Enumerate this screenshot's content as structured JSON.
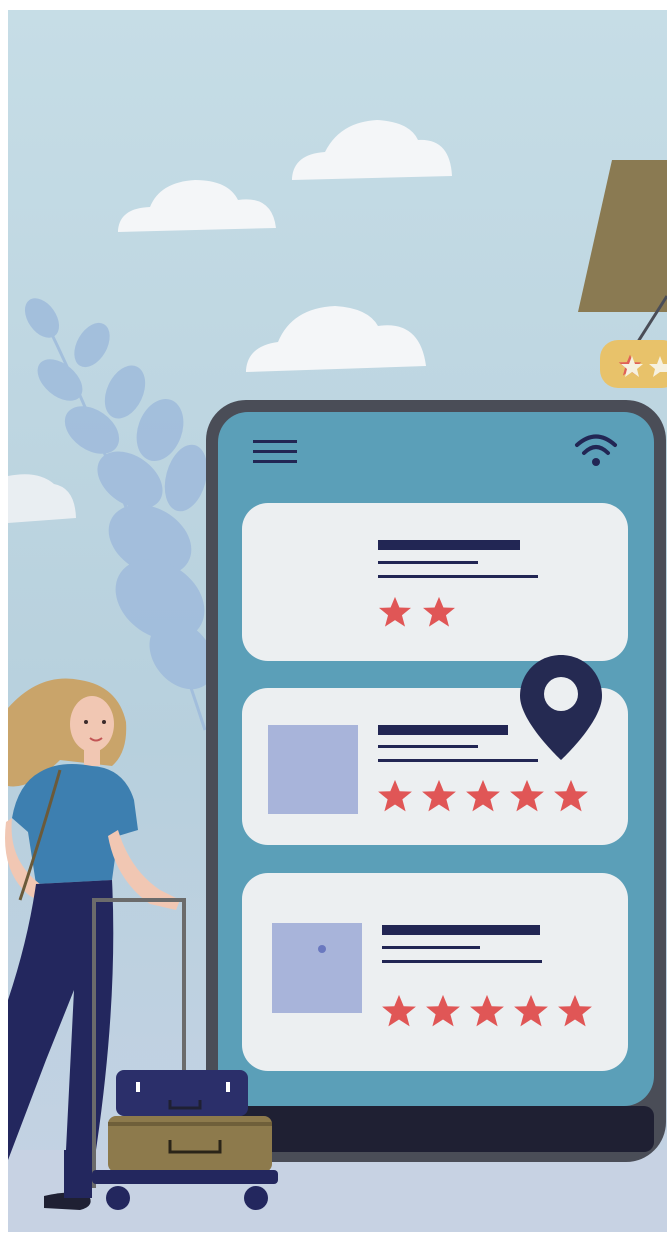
{
  "scene": {
    "description_icons": [
      "menu-icon",
      "wifi-icon",
      "location-pin-icon",
      "star-icon",
      "hanging-sign-stars-icon"
    ],
    "colors": {
      "sky": "#bcd6e0",
      "ground": "#c7d4e4",
      "phone_frame": "#4a4d57",
      "phone_screen": "#5b9fb8",
      "card": "#eceff1",
      "text_line": "#222654",
      "star": "#e05656",
      "thumbnail": "#a8b4da",
      "pin": "#252a52",
      "shirt": "#3d7fb0",
      "pants": "#23275e",
      "hair": "#c9a46a",
      "suitcase_top": "#2b2f6a",
      "suitcase_bottom": "#8d7a4c",
      "sign": "#8a7a52"
    }
  },
  "phone": {
    "cards": [
      {
        "rating": 2,
        "has_thumbnail": false
      },
      {
        "rating": 5,
        "has_thumbnail": true
      },
      {
        "rating": 5,
        "has_thumbnail": true
      }
    ]
  }
}
